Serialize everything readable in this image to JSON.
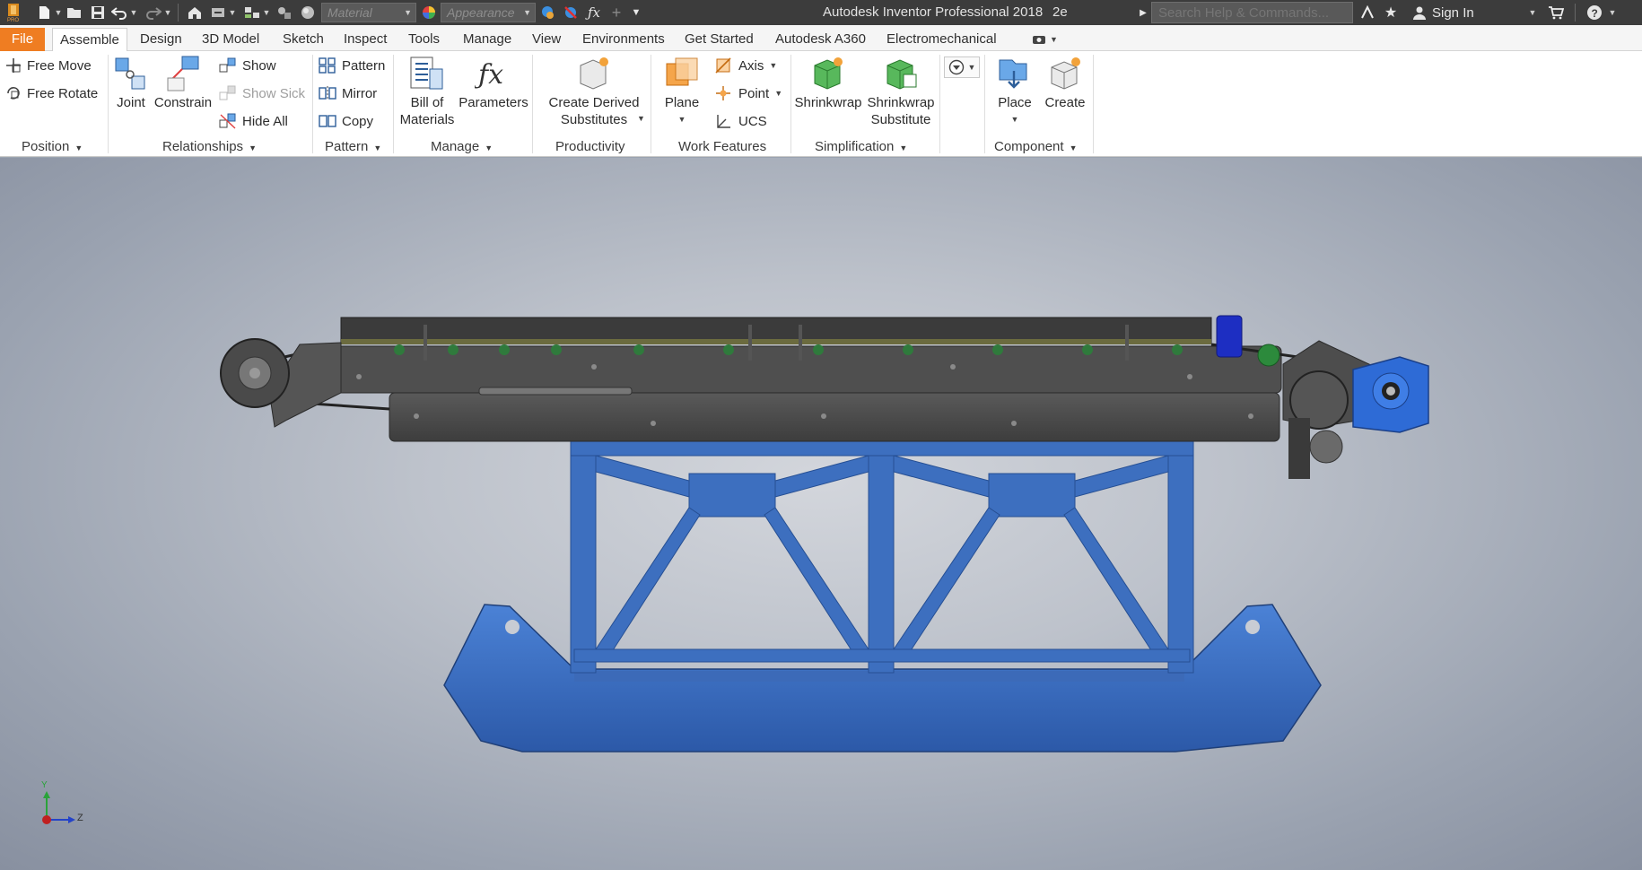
{
  "titlebar": {
    "material_placeholder": "Material",
    "appearance_placeholder": "Appearance",
    "app_title": "Autodesk Inventor Professional 2018",
    "document_name": "2e",
    "search_placeholder": "Search Help & Commands...",
    "sign_in": "Sign In",
    "icons": [
      "inventor-logo-icon",
      "new-file-icon",
      "open-folder-icon",
      "save-icon",
      "undo-icon",
      "redo-icon",
      "home-icon",
      "return-icon",
      "projects-icon",
      "select-icon",
      "color-wheel-icon",
      "clear-appearance-icon",
      "parameters-fx-icon",
      "measure-icon",
      "customize-qat-icon",
      "help-icon",
      "cart-icon",
      "favorites-star-icon",
      "user-icon"
    ]
  },
  "tabs": [
    {
      "label": "File"
    },
    {
      "label": "Assemble"
    },
    {
      "label": "Design"
    },
    {
      "label": "3D Model"
    },
    {
      "label": "Sketch"
    },
    {
      "label": "Inspect"
    },
    {
      "label": "Tools"
    },
    {
      "label": "Manage"
    },
    {
      "label": "View"
    },
    {
      "label": "Environments"
    },
    {
      "label": "Get Started"
    },
    {
      "label": "Autodesk A360"
    },
    {
      "label": "Electromechanical"
    }
  ],
  "ribbon": {
    "position": {
      "title": "Position",
      "free_move": "Free Move",
      "free_rotate": "Free Rotate"
    },
    "relationships": {
      "title": "Relationships",
      "joint": "Joint",
      "constrain": "Constrain",
      "show": "Show",
      "show_sick": "Show Sick",
      "hide_all": "Hide All"
    },
    "pattern": {
      "title": "Pattern",
      "pattern": "Pattern",
      "mirror": "Mirror",
      "copy": "Copy"
    },
    "manage": {
      "title": "Manage",
      "bom_line1": "Bill of",
      "bom_line2": "Materials",
      "parameters": "Parameters"
    },
    "productivity": {
      "title": "Productivity",
      "derived_line1": "Create Derived",
      "derived_line2": "Substitutes"
    },
    "work_features": {
      "title": "Work Features",
      "plane": "Plane",
      "axis": "Axis",
      "point": "Point",
      "ucs": "UCS"
    },
    "simplification": {
      "title": "Simplification",
      "shrinkwrap": "Shrinkwrap",
      "sub_line1": "Shrinkwrap",
      "sub_line2": "Substitute"
    },
    "component": {
      "title": "Component",
      "place": "Place",
      "create": "Create"
    }
  },
  "viewport": {
    "triad": {
      "y_label": "Y",
      "z_label": "Z"
    },
    "model": "conveyor-assembly"
  },
  "colors": {
    "file_tab": "#ef7d22",
    "frame_blue": "#3d6fbf",
    "belt_grey": "#4a4a4a",
    "motor_blue": "#2e6bd6"
  }
}
